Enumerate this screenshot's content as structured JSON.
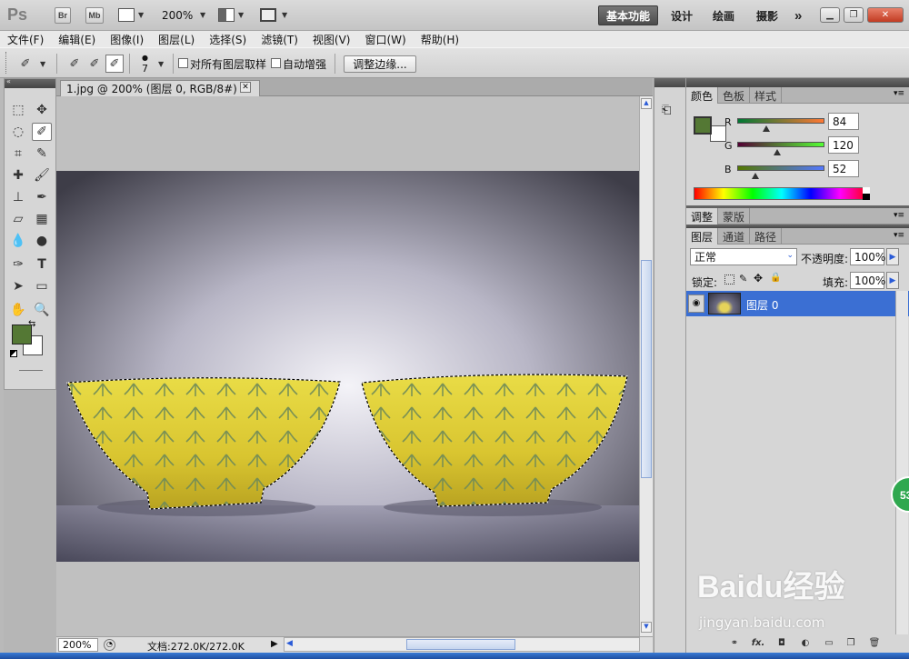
{
  "app": {
    "logo": "Ps",
    "zoom_level": "200%",
    "mini_buttons": [
      "Br",
      "Mb"
    ],
    "workspaces": [
      "基本功能",
      "设计",
      "绘画",
      "摄影"
    ],
    "more": "»"
  },
  "menu": [
    "文件(F)",
    "编辑(E)",
    "图像(I)",
    "图层(L)",
    "选择(S)",
    "滤镜(T)",
    "视图(V)",
    "窗口(W)",
    "帮助(H)"
  ],
  "options": {
    "brush_size": "7",
    "sample_all_layers": "对所有图层取样",
    "auto_enhance": "自动增强",
    "refine_edge": "调整边缘..."
  },
  "document": {
    "tab_title": "1.jpg @ 200% (图层 0, RGB/8#) *",
    "status_zoom": "200%",
    "status_doc": "文档:272.0K/272.0K"
  },
  "color_panel": {
    "tabs": [
      "颜色",
      "色板",
      "样式"
    ],
    "r_label": "R",
    "g_label": "G",
    "b_label": "B",
    "r": "84",
    "g": "120",
    "b": "52",
    "foreground": "#547834"
  },
  "adjust_panel": {
    "tabs": [
      "调整",
      "蒙版"
    ]
  },
  "layers_panel": {
    "tabs": [
      "图层",
      "通道",
      "路径"
    ],
    "blend_mode": "正常",
    "opacity_label": "不透明度:",
    "opacity": "100%",
    "lock_label": "锁定:",
    "fill_label": "填充:",
    "fill": "100%",
    "layer_name": "图层 0"
  },
  "watermark": {
    "brand": "Baidu经验",
    "url": "jingyan.baidu.com"
  },
  "badge": "53"
}
